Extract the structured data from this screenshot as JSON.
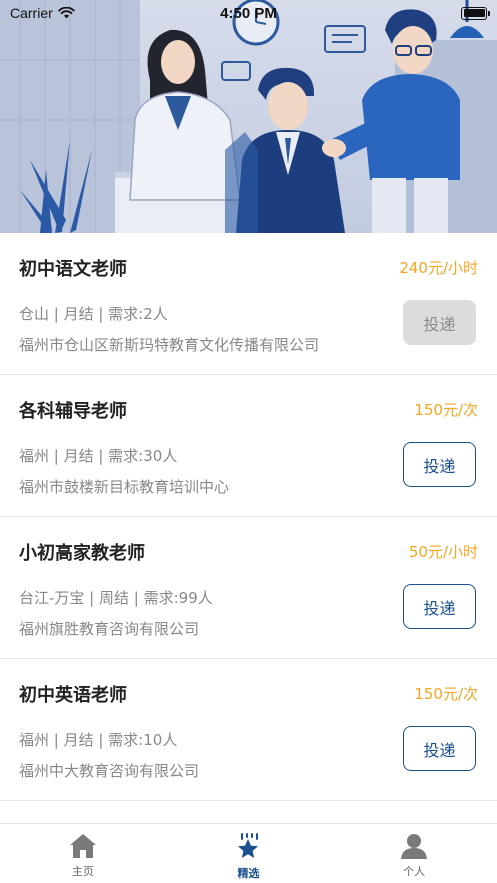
{
  "status": {
    "carrier": "Carrier",
    "time": "4:50 PM"
  },
  "jobs": [
    {
      "title": "初中语文老师",
      "salary": "240元/小时",
      "meta": "仓山 | 月结 | 需求:2人",
      "company": "福州市仓山区新斯玛特教育文化传播有限公司",
      "apply_label": "投递",
      "apply_enabled": false
    },
    {
      "title": "各科辅导老师",
      "salary": "150元/次",
      "meta": "福州 | 月结 | 需求:30人",
      "company": "福州市鼓楼新目标教育培训中心",
      "apply_label": "投递",
      "apply_enabled": true
    },
    {
      "title": "小初高家教老师",
      "salary": "50元/小时",
      "meta": "台江-万宝 | 周结 | 需求:99人",
      "company": "福州旗胜教育咨询有限公司",
      "apply_label": "投递",
      "apply_enabled": true
    },
    {
      "title": "初中英语老师",
      "salary": "150元/次",
      "meta": "福州 | 月结 | 需求:10人",
      "company": "福州中大教育咨询有限公司",
      "apply_label": "投递",
      "apply_enabled": true
    }
  ],
  "tabs": [
    {
      "label": "主页",
      "icon": "home-icon",
      "active": false
    },
    {
      "label": "精选",
      "icon": "star-icon",
      "active": true
    },
    {
      "label": "个人",
      "icon": "person-icon",
      "active": false
    }
  ],
  "colors": {
    "accent": "#1a4f8f",
    "salary": "#f5a623",
    "disabled_bg": "#dcdcdc"
  }
}
